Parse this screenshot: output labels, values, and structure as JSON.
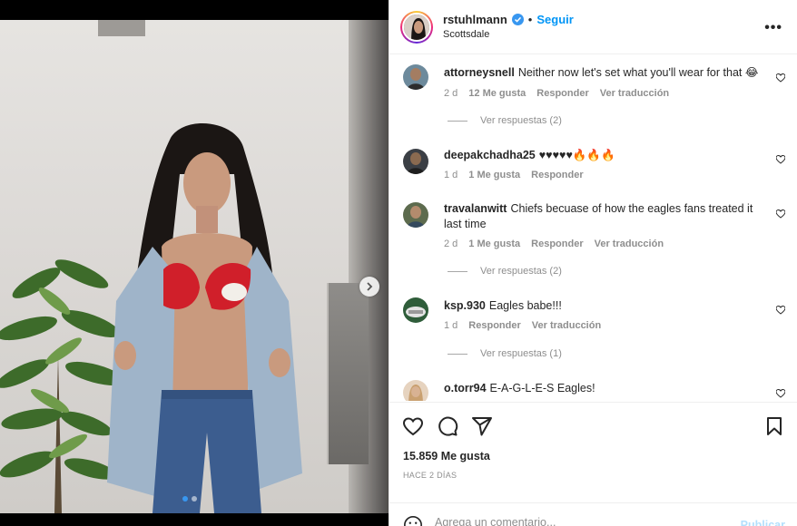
{
  "post": {
    "username": "rstuhlmann",
    "follow_label": "Seguir",
    "separator": "•",
    "location": "Scottsdale",
    "more_label": "•••"
  },
  "comments": [
    {
      "username": "attorneysnell",
      "text": "Neither now let's set what you'll wear for that 😂",
      "time": "2 d",
      "likes": "12 Me gusta",
      "reply_label": "Responder",
      "translate_label": "Ver traducción",
      "view_replies": "Ver respuestas (2)"
    },
    {
      "username": "deepakchadha25",
      "text": "♥♥♥♥♥🔥🔥🔥",
      "time": "1 d",
      "likes": "1 Me gusta",
      "reply_label": "Responder"
    },
    {
      "username": "travalanwitt",
      "text": "Chiefs becuase of how the eagles fans treated it last time",
      "time": "2 d",
      "likes": "1 Me gusta",
      "reply_label": "Responder",
      "translate_label": "Ver traducción",
      "view_replies": "Ver respuestas (2)"
    },
    {
      "username": "ksp.930",
      "text": "Eagles babe!!!",
      "time": "1 d",
      "reply_label": "Responder",
      "translate_label": "Ver traducción",
      "view_replies": "Ver respuestas (1)"
    },
    {
      "username": "o.torr94",
      "text": "E-A-G-L-E-S Eagles!"
    }
  ],
  "actions": {
    "likes_count": "15.859 Me gusta",
    "date": "HACE 2 DÍAS",
    "comment_placeholder": "Agrega un comentario...",
    "publish_label": "Publicar"
  },
  "icons": [
    "heart-icon",
    "comment-icon",
    "share-icon",
    "bookmark-icon",
    "emoji-icon",
    "verified-icon",
    "chevron-right-icon"
  ],
  "colors": {
    "accent": "#0095f6",
    "verified": "#3897f0",
    "publish_disabled": "#b2dffc",
    "muted": "#8e8e8e"
  }
}
